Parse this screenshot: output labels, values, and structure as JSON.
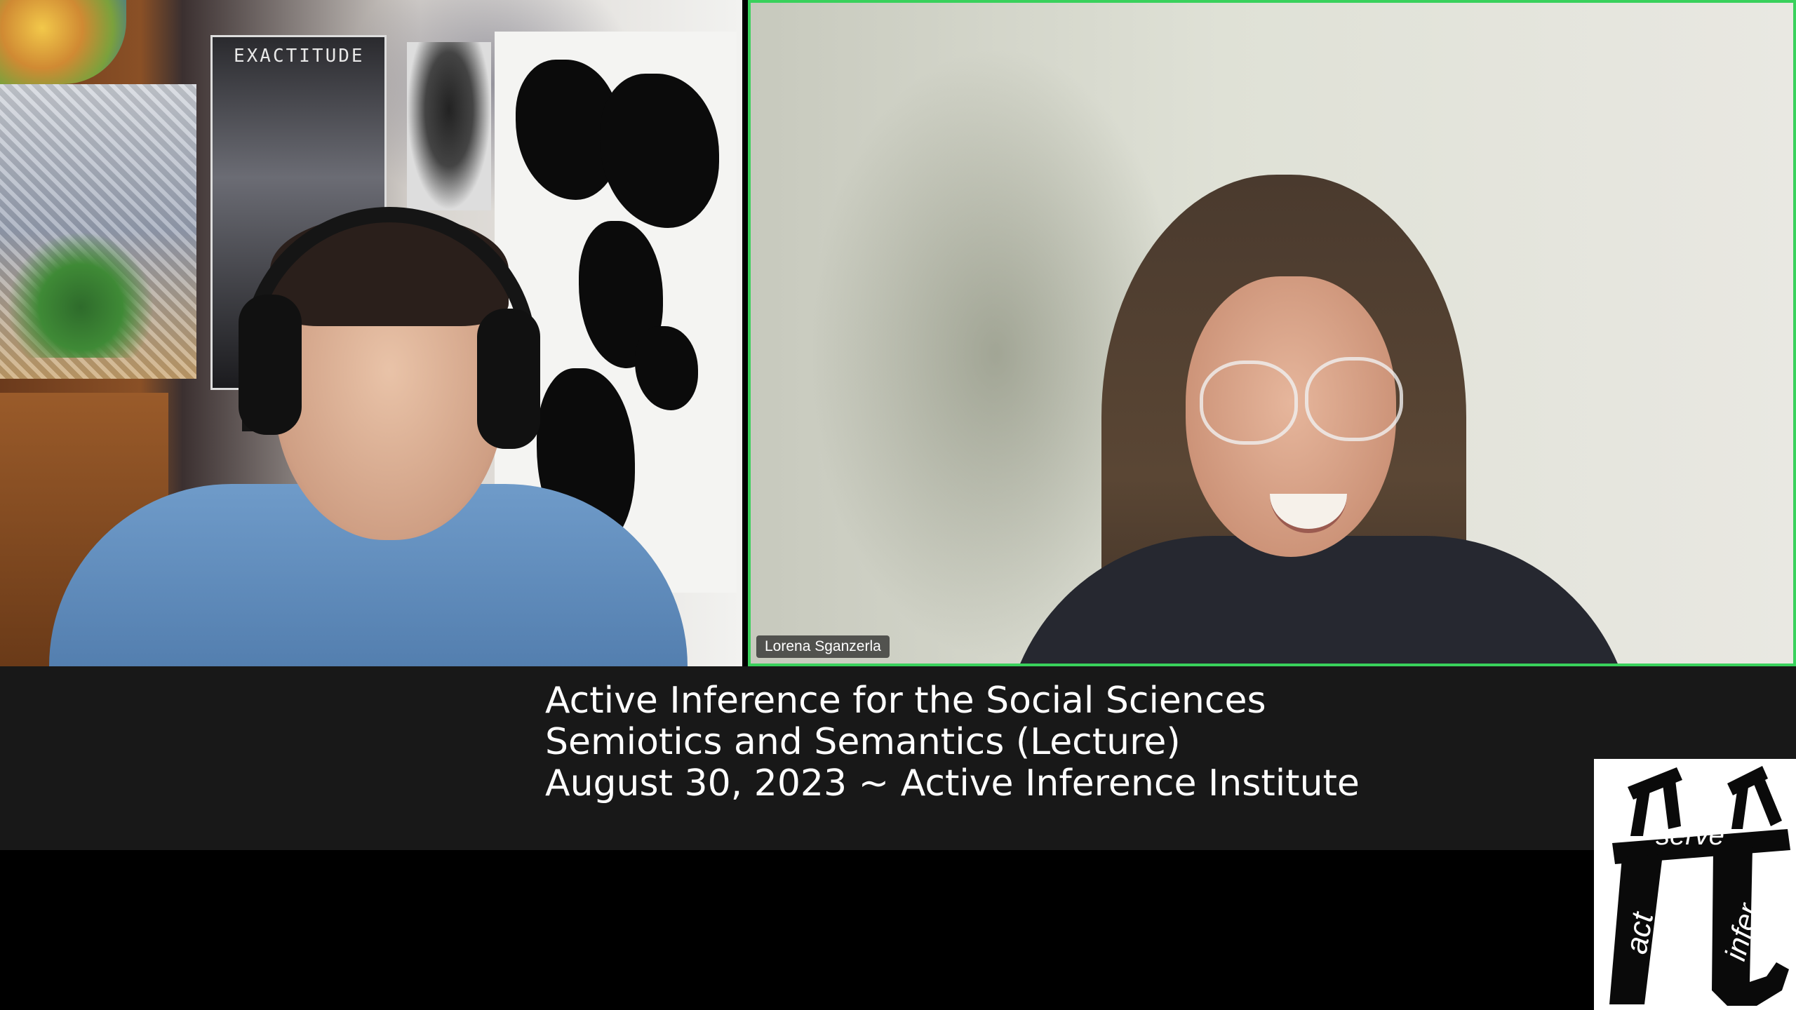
{
  "participants": [
    {
      "name": "",
      "tile": "left"
    },
    {
      "name": "Lorena Sganzerla",
      "tile": "right",
      "active_speaker": true
    }
  ],
  "poster_text": "EXACTITUDE",
  "caption": {
    "line1": "Active Inference for the Social Sciences",
    "line2": "Semiotics and Semantics (Lecture)",
    "line3": "August 30, 2023 ~ Active Inference Institute"
  },
  "logo": {
    "word_top": "serve",
    "word_left": "act",
    "word_right": "infer"
  },
  "colors": {
    "active_speaker_border": "#39d15c",
    "caption_band": "#181818",
    "background": "#000000"
  }
}
